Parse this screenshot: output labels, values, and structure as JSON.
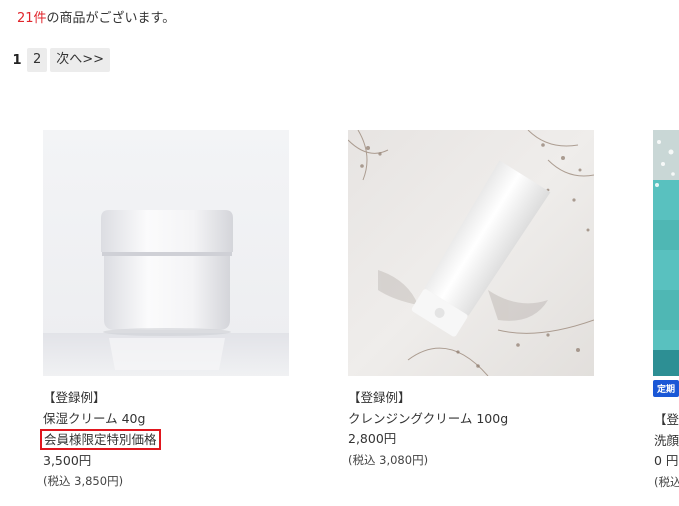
{
  "results": {
    "count": "21件",
    "suffix": "の商品がございます。"
  },
  "pagination": {
    "current": "1",
    "page2": "2",
    "next": "次へ>>"
  },
  "products": [
    {
      "tag": "【登録例】",
      "name": "保湿クリーム 40g",
      "member_label": "会員様限定特別価格",
      "price": "3,500円",
      "tax": "(税込 3,850円)"
    },
    {
      "tag": "【登録例】",
      "name": "クレンジングクリーム 100g",
      "price": "2,800円",
      "tax": "(税込 3,080円)"
    },
    {
      "badge": "定期",
      "tag": "【登",
      "name": "洗顔",
      "price": "0 円",
      "tax": "(税込"
    }
  ]
}
